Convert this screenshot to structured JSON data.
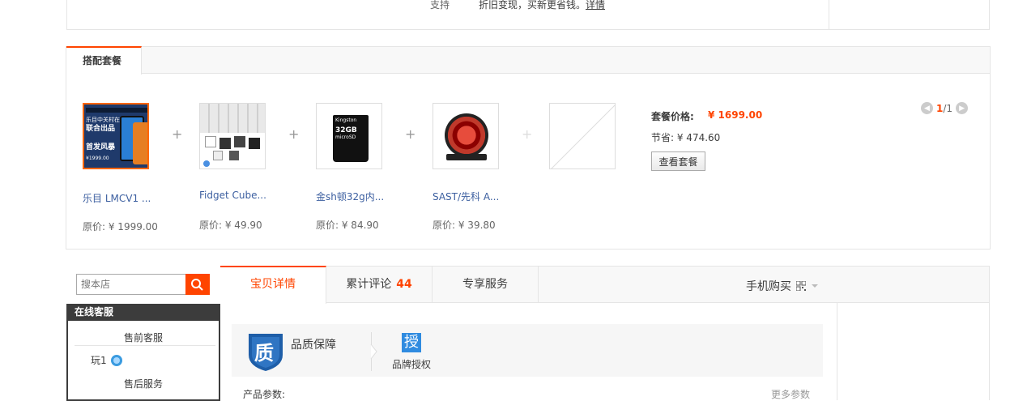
{
  "trade_in": {
    "support_label": "支持",
    "description": "折旧变现，买新更省钱。",
    "details_link": "详情"
  },
  "bundle": {
    "tab_label": "搭配套餐",
    "items": [
      {
        "name": "乐目 LMCV1 ...",
        "price": "原价: ¥ 1999.00",
        "thumb_lines": [
          "乐目中关村在线",
          "联合出品",
          "首发风暴",
          "¥1999.00"
        ]
      },
      {
        "name": "Fidget Cube...",
        "price": "原价: ¥ 49.90"
      },
      {
        "name": "金sh顿32g内...",
        "price": "原价: ¥ 84.90",
        "thumb_lines": [
          "Kingston",
          "32GB",
          "microSD"
        ]
      },
      {
        "name": "SAST/先科 A...",
        "price": "原价: ¥ 39.80"
      }
    ],
    "package_price_label": "套餐价格:",
    "package_price": "¥ 1699.00",
    "savings": "节省: ¥ 474.60",
    "view_button": "查看套餐",
    "pager_current": "1",
    "pager_total": "/1",
    "colors": {
      "accent": "#ff4400"
    }
  },
  "sidebar": {
    "search_placeholder": "搜本店",
    "cs_title": "在线客服",
    "presale_label": "售前客服",
    "user_name": "玩1",
    "aftersale_label": "售后服务"
  },
  "tabs": {
    "detail": "宝贝详情",
    "reviews": "累计评论",
    "reviews_count": "44",
    "service": "专享服务",
    "mobile_buy": "手机购买"
  },
  "quality": {
    "badge_char": "质",
    "title": "品质保障",
    "auth_char": "授",
    "auth_label": "品牌授权"
  },
  "below": {
    "params_label": "产品参数:",
    "more_label": "更多参数"
  }
}
